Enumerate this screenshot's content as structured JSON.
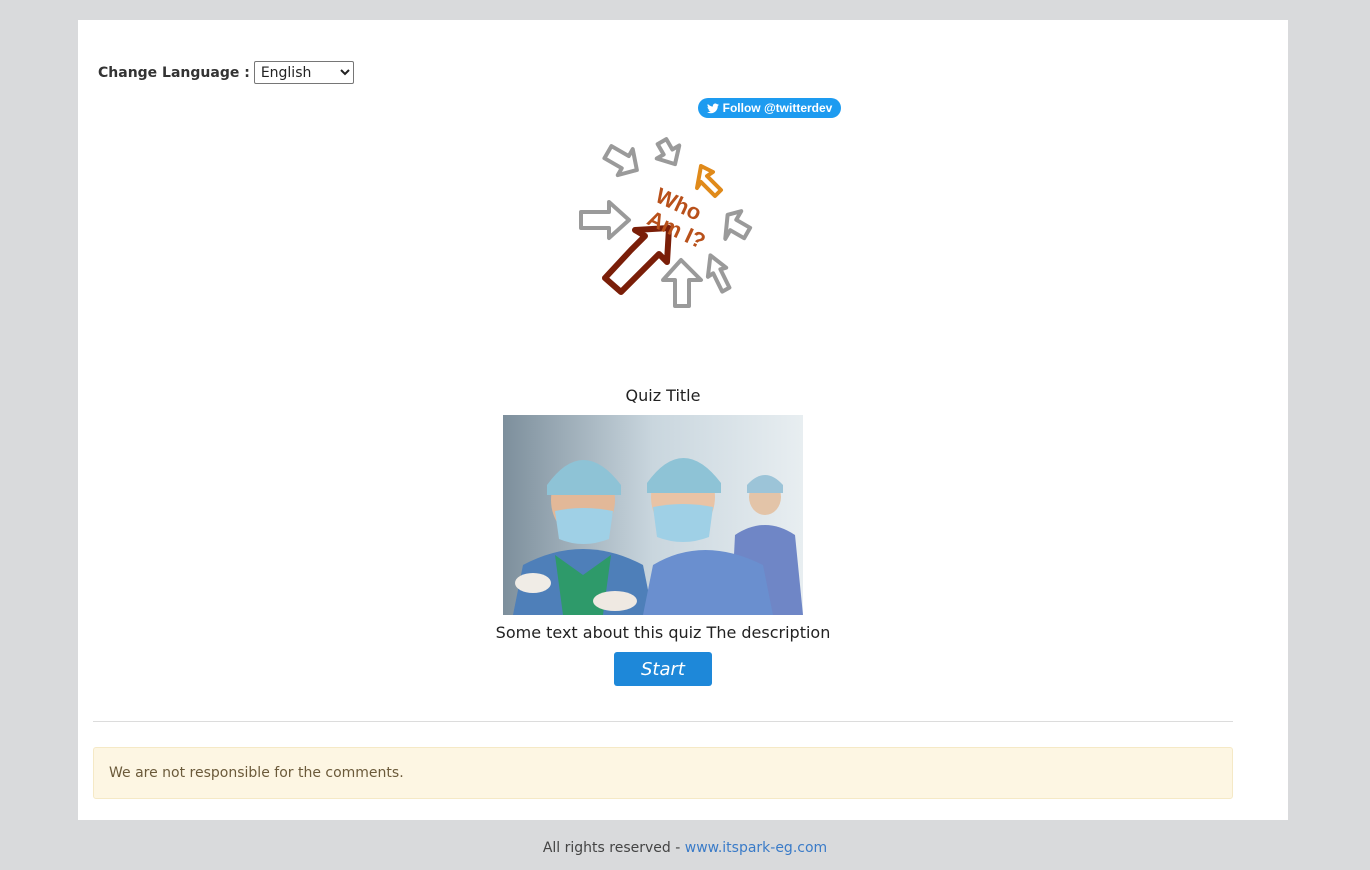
{
  "language": {
    "label": "Change Language :",
    "selected": "English"
  },
  "twitter": {
    "follow_label": "Follow @twitterdev"
  },
  "logo": {
    "text_line1": "Who",
    "text_line2": "Am I?"
  },
  "quiz": {
    "title": "Quiz Title",
    "description": "Some text about this quiz The description",
    "start_label": "Start"
  },
  "notice": {
    "text": "We are not responsible for the comments."
  },
  "footer": {
    "prefix": "All rights reserved - ",
    "link_text": "www.itspark-eg.com"
  },
  "colors": {
    "page_bg": "#d9dadc",
    "card_bg": "#ffffff",
    "twitter_blue": "#1d9bf0",
    "start_blue": "#1e88d9",
    "notice_bg": "#fdf6e3",
    "link_blue": "#3a7bc8"
  }
}
